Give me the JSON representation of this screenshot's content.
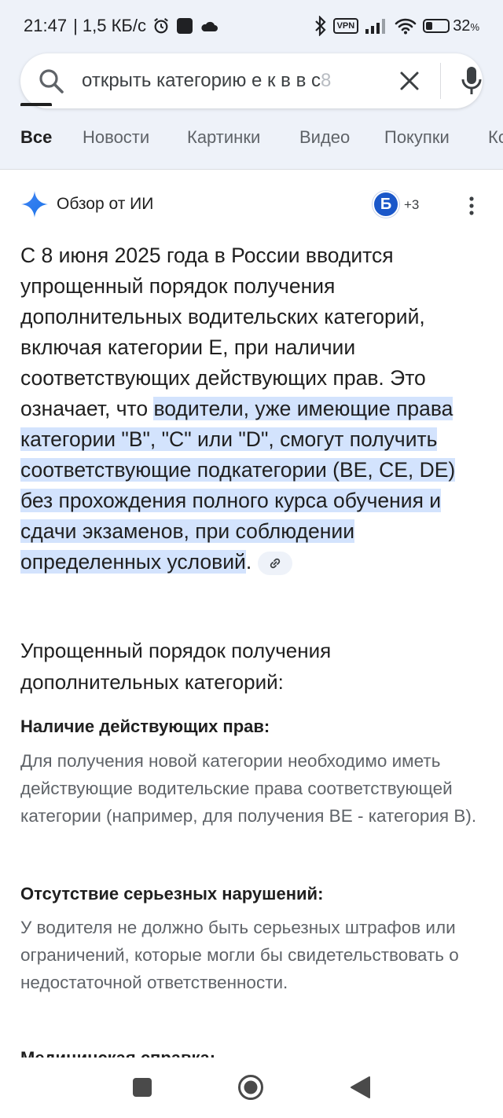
{
  "status_bar": {
    "time": "21:47",
    "speed": "| 1,5 КБ/с",
    "vpn": "VPN",
    "battery_percent": "32",
    "battery_unit": "%",
    "battery_level": 0.32
  },
  "search": {
    "query": "открыть категорию е к в в с ",
    "query_fade": "8"
  },
  "tabs": [
    {
      "label": "Все",
      "active": true
    },
    {
      "label": "Новости",
      "active": false
    },
    {
      "label": "Картинки",
      "active": false
    },
    {
      "label": "Видео",
      "active": false
    },
    {
      "label": "Покупки",
      "active": false
    },
    {
      "label": "Ко",
      "active": false
    }
  ],
  "ai_overview": {
    "title": "Обзор от ИИ",
    "source_logo_letter": "Б",
    "source_count": "+3",
    "intro": "С 8 июня 2025 года в России вводится упрощенный порядок получения дополнительных водительских категорий, включая категории Е, при наличии соответствующих действующих прав. Это означает, что ",
    "highlight": "водители, уже имеющие права категории \"B\", \"C\" или \"D\", смогут получить соответствующие подкатегории (BE, CE, DE) без прохождения полного курса обучения и сдачи экзаменов, при соблюдении определенных условий",
    "after_highlight": ".",
    "section_title": "Упрощенный порядок получения дополнительных категорий:",
    "items": [
      {
        "heading": "Наличие действующих прав:",
        "text": "Для получения новой категории необходимо иметь действующие водительские права соответствующей категории (например, для получения BE - категория B)."
      },
      {
        "heading": "Отсутствие серьезных нарушений:",
        "text": "У водителя не должно быть серьезных штрафов или ограничений, которые могли бы свидетельствовать о недостаточной ответственности."
      }
    ],
    "cut_heading": "Медицинская справка:"
  }
}
